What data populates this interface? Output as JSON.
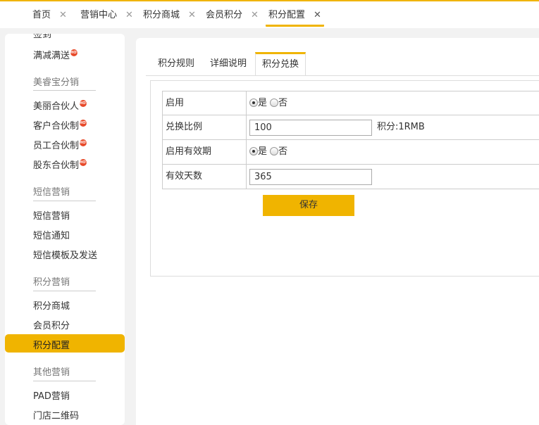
{
  "tabs": [
    {
      "label": "首页"
    },
    {
      "label": "营销中心"
    },
    {
      "label": "积分商城"
    },
    {
      "label": "会员积分"
    },
    {
      "label": "积分配置"
    }
  ],
  "sidebar": {
    "items": {
      "signin": "签到",
      "fullreduce": "满减满送",
      "beauty_partner": "美丽合伙人",
      "customer_partner": "客户合伙制",
      "staff_partner": "员工合伙制",
      "shareholder_partner": "股东合伙制",
      "sms_marketing": "短信营销",
      "sms_notice": "短信通知",
      "sms_template": "短信模板及发送",
      "points_mall": "积分商城",
      "member_points": "会员积分",
      "points_config": "积分配置",
      "pad_marketing": "PAD营销",
      "store_qrcode": "门店二维码"
    },
    "groups": {
      "meirongbao": "美睿宝分销",
      "sms": "短信营销",
      "points": "积分营销",
      "other": "其他营销"
    },
    "hot_badge": "HOT"
  },
  "content_tabs": [
    {
      "label": "积分规则"
    },
    {
      "label": "详细说明"
    },
    {
      "label": "积分兑换"
    }
  ],
  "form": {
    "enable": {
      "label": "启用",
      "yes": "是",
      "no": "否"
    },
    "ratio": {
      "label": "兑换比例",
      "value": "100",
      "suffix": "积分:1RMB"
    },
    "validity": {
      "label": "启用有效期",
      "yes": "是",
      "no": "否"
    },
    "days": {
      "label": "有效天数",
      "value": "365"
    },
    "save_label": "保存"
  },
  "colors": {
    "accent": "#f0b400"
  }
}
